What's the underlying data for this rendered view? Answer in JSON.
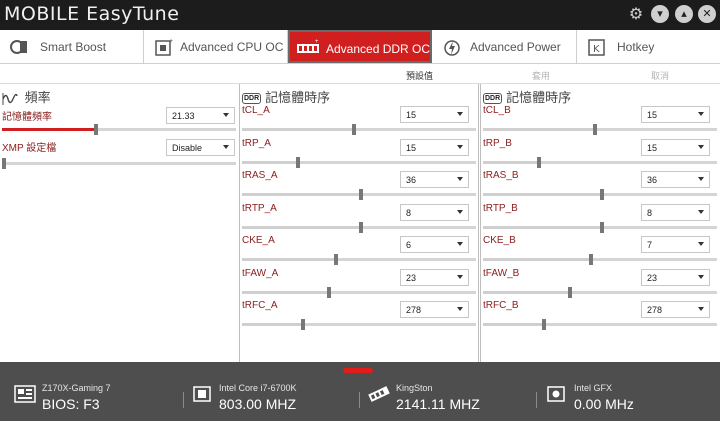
{
  "app": {
    "title": "MOBILE EasyTune"
  },
  "window": {
    "gear_icon": "gear-icon",
    "minimize_icon": "minimize-icon",
    "close_icon": "close-icon"
  },
  "tabs": [
    {
      "label": "Smart Boost",
      "icon": "smart-boost-icon",
      "active": false
    },
    {
      "label": "Advanced CPU OC",
      "icon": "cpu-icon",
      "active": false
    },
    {
      "label": "Advanced DDR OC",
      "icon": "ram-icon",
      "active": true
    },
    {
      "label": "Advanced Power",
      "icon": "power-icon",
      "active": false
    },
    {
      "label": "Hotkey",
      "icon": "hotkey-icon",
      "active": false
    }
  ],
  "columns": {
    "default": "預設值",
    "apply": "套用",
    "cancel": "取消"
  },
  "colors": {
    "accent": "#d11f1f",
    "status_bg": "#4e4e4e",
    "titlebar_bg": "#1c1c1c"
  },
  "freq_panel": {
    "title": "頻率",
    "rows": [
      {
        "label": "記憶體頻率",
        "value": "21.33",
        "level": 0.4
      },
      {
        "label": "XMP 設定檔",
        "value": "Disable",
        "level": 0.0
      }
    ]
  },
  "ddr_panel_a": {
    "title": "記憶體時序",
    "badge": "DDR",
    "rows": [
      {
        "label": "tCL_A",
        "value": "15",
        "level": 0.48
      },
      {
        "label": "tRP_A",
        "value": "15",
        "level": 0.24
      },
      {
        "label": "tRAS_A",
        "value": "36",
        "level": 0.51
      },
      {
        "label": "tRTP_A",
        "value": "8",
        "level": 0.51
      },
      {
        "label": "CKE_A",
        "value": "6",
        "level": 0.4
      },
      {
        "label": "tFAW_A",
        "value": "23",
        "level": 0.37
      },
      {
        "label": "tRFC_A",
        "value": "278",
        "level": 0.26
      }
    ]
  },
  "ddr_panel_b": {
    "title": "記憶體時序",
    "badge": "DDR",
    "rows": [
      {
        "label": "tCL_B",
        "value": "15",
        "level": 0.48
      },
      {
        "label": "tRP_B",
        "value": "15",
        "level": 0.24
      },
      {
        "label": "tRAS_B",
        "value": "36",
        "level": 0.51
      },
      {
        "label": "tRTP_B",
        "value": "8",
        "level": 0.51
      },
      {
        "label": "CKE_B",
        "value": "7",
        "level": 0.46
      },
      {
        "label": "tFAW_B",
        "value": "23",
        "level": 0.37
      },
      {
        "label": "tRFC_B",
        "value": "278",
        "level": 0.26
      }
    ]
  },
  "status": [
    {
      "name": "Z170X-Gaming 7",
      "value": "BIOS: F3",
      "icon": "motherboard-icon"
    },
    {
      "name": "Intel Core i7-6700K",
      "value": "803.00 MHZ",
      "icon": "cpu-chip-icon"
    },
    {
      "name": "KingSton",
      "value": "2141.11 MHZ",
      "icon": "memory-icon"
    },
    {
      "name": "Intel GFX",
      "value": "0.00 MHz",
      "icon": "gpu-icon"
    }
  ]
}
